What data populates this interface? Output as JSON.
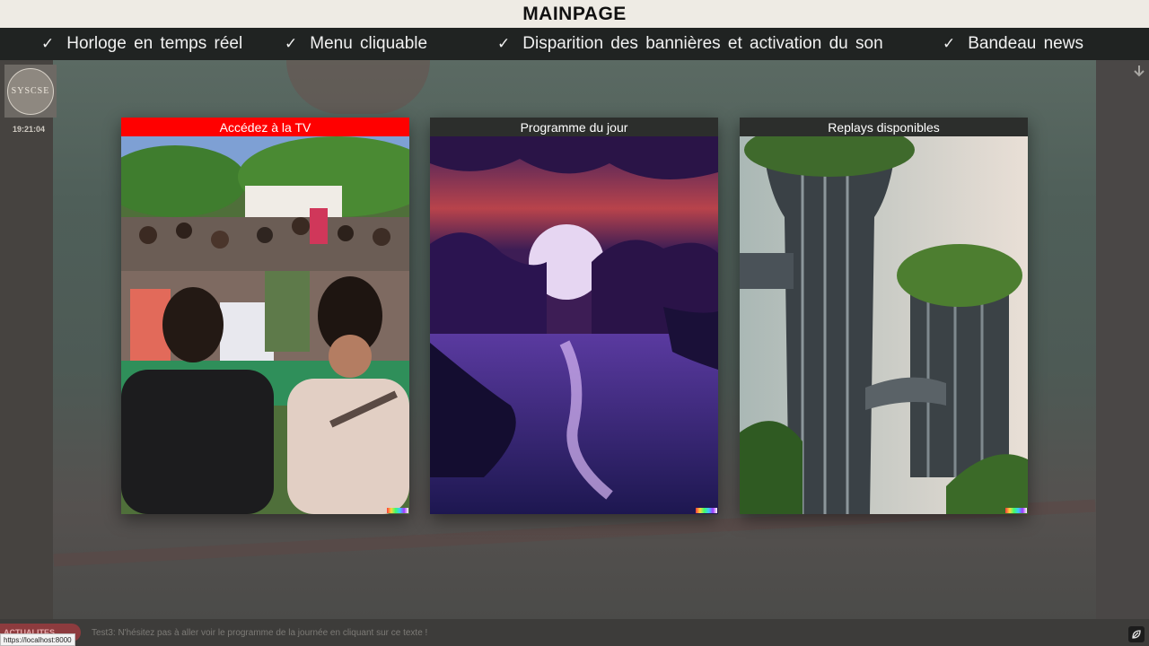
{
  "header": {
    "title": "MAINPAGE"
  },
  "features": [
    {
      "check": "✓",
      "label": "Horloge en temps réel"
    },
    {
      "check": "✓",
      "label": "Menu cliquable"
    },
    {
      "check": "✓",
      "label": "Disparition des bannières et activation du son"
    },
    {
      "check": "✓",
      "label": "Bandeau news"
    }
  ],
  "sidebar": {
    "logo_text": "SYSCSE",
    "clock": "19:21:04"
  },
  "icons": {
    "scroll_down": "arrow-down-icon",
    "corner": "leaf-icon"
  },
  "cards": [
    {
      "title": "Accédez à la TV",
      "header_color": "#ff0000",
      "image": "crowd-watching-outdoor-screen"
    },
    {
      "title": "Programme du jour",
      "header_color": "#2c2e2c",
      "image": "purple-sunset-over-water"
    },
    {
      "title": "Replays disponibles",
      "header_color": "#2c2e2c",
      "image": "futuristic-overgrown-towers"
    }
  ],
  "ticker": {
    "label": "ACTUALITES",
    "text": "Test3: N'hésitez pas à aller voir le programme de la journée en cliquant sur ce texte !"
  },
  "status_url": "https://localhost:8000"
}
